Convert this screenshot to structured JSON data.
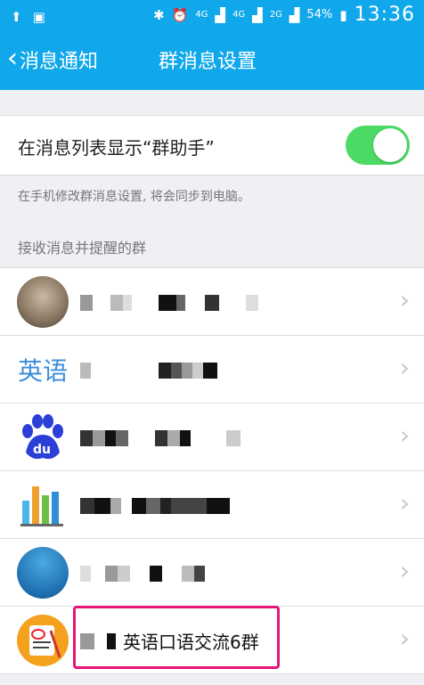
{
  "statusbar": {
    "time": "13:36",
    "battery": "54%",
    "network_label_1": "4G",
    "network_label_2": "4G",
    "network_label_3": "2G",
    "icons": [
      "upload-icon",
      "image-icon",
      "bluetooth-icon",
      "alarm-icon",
      "signal-icon",
      "battery-icon"
    ]
  },
  "nav": {
    "back_label": "消息通知",
    "title": "群消息设置"
  },
  "settings": {
    "toggle_label": "在消息列表显示“群助手”",
    "toggle_on": true,
    "hint": "在手机修改群消息设置, 将会同步到电脑。",
    "section_header": "接收消息并提醒的群"
  },
  "groups": [
    {
      "avatar": "photo-avatar",
      "name_visible": ""
    },
    {
      "avatar": "english-text-avatar",
      "avatar_text": "英语",
      "name_visible": ""
    },
    {
      "avatar": "baidu-paw-avatar",
      "name_visible": ""
    },
    {
      "avatar": "bar-chart-avatar",
      "name_visible": ""
    },
    {
      "avatar": "handshake-avatar",
      "name_visible": ""
    },
    {
      "avatar": "notebook-avatar",
      "name_visible": "英语口语交流6群"
    }
  ],
  "colors": {
    "accent": "#10a8eb",
    "switch_on": "#4cd964",
    "highlight": "#e5157a"
  }
}
